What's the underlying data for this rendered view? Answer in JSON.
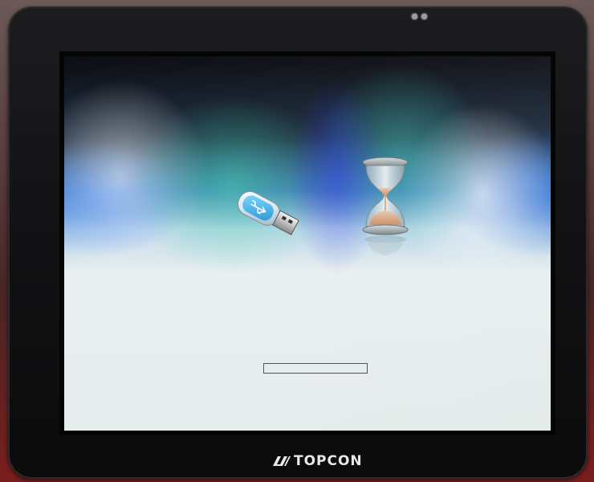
{
  "device": {
    "brand": "TOPCON",
    "brand_icon": "topcon-logo-mark",
    "bezel_color": "#141416"
  },
  "screen": {
    "icons": {
      "usb": "usb-flash-drive-icon",
      "hourglass": "hourglass-icon"
    },
    "progress": {
      "value": 0,
      "fill_color": "#3b6fb0",
      "border_color": "#505458"
    }
  }
}
